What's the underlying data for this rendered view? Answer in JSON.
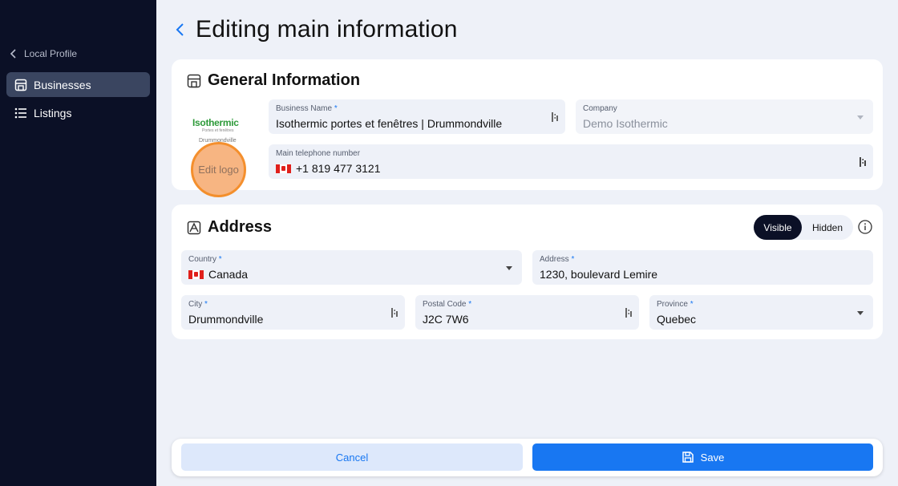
{
  "sidebar": {
    "back_label": "Local Profile",
    "items": [
      {
        "label": "Businesses",
        "icon": "store-icon",
        "active": true
      },
      {
        "label": "Listings",
        "icon": "list-icon",
        "active": false
      }
    ]
  },
  "header": {
    "title": "Editing main information"
  },
  "general": {
    "title": "General Information",
    "logo": {
      "brand": "Isothermic",
      "tagline": "Portes et fenêtres",
      "city": "Drummondville",
      "edit_label": "Edit logo"
    },
    "business_name": {
      "label": "Business Name",
      "required": "*",
      "value": "Isothermic portes et fenêtres | Drummondville"
    },
    "company": {
      "label": "Company",
      "value": "Demo Isothermic"
    },
    "phone": {
      "label": "Main telephone number",
      "value": "+1 819 477 3121",
      "country_flag": "CA"
    }
  },
  "address": {
    "title": "Address",
    "visibility": {
      "visible_label": "Visible",
      "hidden_label": "Hidden",
      "selected": "Visible"
    },
    "country": {
      "label": "Country",
      "required": "*",
      "value": "Canada",
      "flag": "CA"
    },
    "street": {
      "label": "Address",
      "required": "*",
      "value": "1230, boulevard Lemire"
    },
    "city": {
      "label": "City",
      "required": "*",
      "value": "Drummondville"
    },
    "postal": {
      "label": "Postal Code",
      "required": "*",
      "value": "J2C 7W6"
    },
    "province": {
      "label": "Province",
      "required": "*",
      "value": "Quebec"
    }
  },
  "footer": {
    "cancel_label": "Cancel",
    "save_label": "Save"
  },
  "colors": {
    "sidebar_bg": "#0b1026",
    "accent": "#1877f2",
    "page_bg": "#eef1f8",
    "highlight": "#f48a22"
  }
}
